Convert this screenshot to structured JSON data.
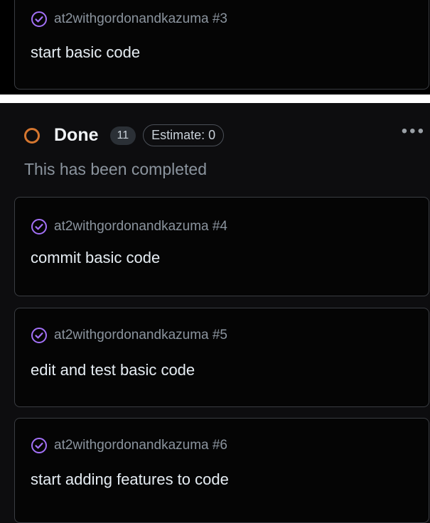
{
  "top_card": {
    "ref": "at2withgordonandkazuma #3",
    "title": "start basic code"
  },
  "separator_text": "",
  "column": {
    "title": "Done",
    "count": "11",
    "estimate": "Estimate: 0",
    "description": "This has been completed",
    "status_color": "#d5762f"
  },
  "cards": [
    {
      "ref": "at2withgordonandkazuma #4",
      "title": "commit basic code"
    },
    {
      "ref": "at2withgordonandkazuma #5",
      "title": "edit and test basic code"
    },
    {
      "ref": "at2withgordonandkazuma #6",
      "title": "start adding features to code"
    }
  ],
  "icons": {
    "issue_closed": "check-circle-icon",
    "more": "more-options-icon"
  },
  "colors": {
    "accent_purple": "#a371f7",
    "background": "#0d0d0f",
    "card_border": "#3a3d42"
  }
}
